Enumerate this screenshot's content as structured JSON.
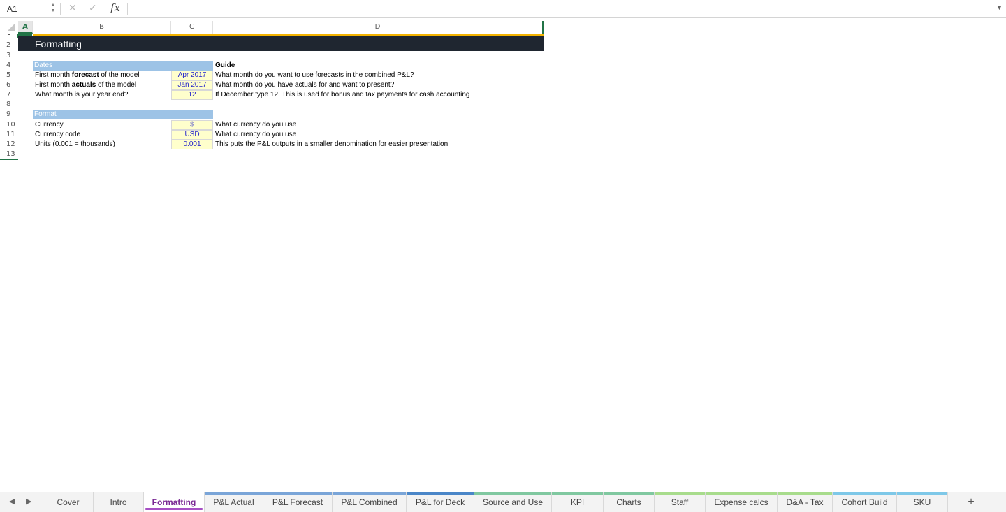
{
  "formula_bar": {
    "name_box": "A1",
    "fx_label": "fx",
    "formula_value": ""
  },
  "columns": [
    "A",
    "B",
    "C",
    "D"
  ],
  "rows": [
    "2",
    "3",
    "4",
    "5",
    "6",
    "7",
    "8",
    "9",
    "10",
    "11",
    "12",
    "13"
  ],
  "sheet": {
    "title": "Formatting",
    "dates": {
      "header": "Dates",
      "guide_header": "Guide",
      "rows": [
        {
          "label_pre": "First month ",
          "label_bold": "forecast",
          "label_post": " of the model",
          "value": "Apr 2017",
          "guide": "What month do you want to use forecasts in the combined P&L?"
        },
        {
          "label_pre": "First month ",
          "label_bold": "actuals",
          "label_post": " of the model",
          "value": "Jan 2017",
          "guide": "What month do you have actuals for and want to present?"
        },
        {
          "label_pre": "What month is your year end?",
          "label_bold": "",
          "label_post": "",
          "value": "12",
          "guide": "If December type 12. This is used for bonus and tax payments for cash accounting"
        }
      ]
    },
    "format": {
      "header": "Format",
      "rows": [
        {
          "label": "Currency",
          "value": "$",
          "guide": "What currency do you use"
        },
        {
          "label": "Currency code",
          "value": "USD",
          "guide": "What currency do you use"
        },
        {
          "label": "Units (0.001 = thousands)",
          "value": "0.001",
          "guide": "This puts the P&L outputs in a smaller denomination for easier presentation"
        }
      ]
    }
  },
  "tabs": [
    {
      "label": "Cover",
      "color": ""
    },
    {
      "label": "Intro",
      "color": ""
    },
    {
      "label": "Formatting",
      "color": "",
      "active": true
    },
    {
      "label": "P&L Actual",
      "color": "#7aa5d8"
    },
    {
      "label": "P&L Forecast",
      "color": "#7aa5d8"
    },
    {
      "label": "P&L Combined",
      "color": "#7aa5d8"
    },
    {
      "label": "P&L for Deck",
      "color": "#4a86c8"
    },
    {
      "label": "Source and Use",
      "color": "#80c8a0"
    },
    {
      "label": "KPI",
      "color": "#80c8a0"
    },
    {
      "label": "Charts",
      "color": "#80c8a0"
    },
    {
      "label": "Staff",
      "color": "#a8dc8c"
    },
    {
      "label": "Expense calcs",
      "color": "#a8dc8c"
    },
    {
      "label": "D&A - Tax",
      "color": "#a8dc8c"
    },
    {
      "label": "Cohort Build",
      "color": "#7ec8e8"
    },
    {
      "label": "SKU",
      "color": "#7ec8e8"
    }
  ],
  "add_tab_label": "+",
  "colors": {
    "title_band": "#1f2630",
    "accent_yellow": "#f3b300",
    "section_header": "#9dc3e6",
    "input_fill": "#ffffcc",
    "input_text": "#2222cc",
    "excel_green": "#217346",
    "active_tab": "#7a2a94"
  }
}
